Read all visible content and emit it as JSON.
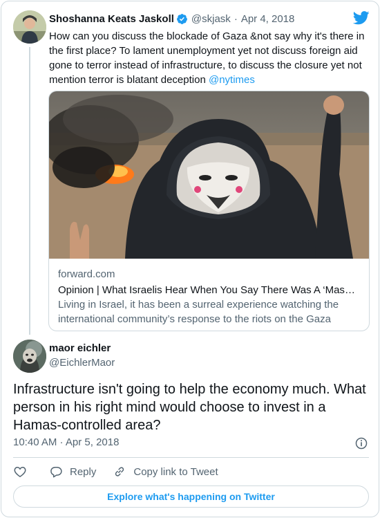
{
  "colors": {
    "accent": "#1d9bf0",
    "muted": "#536471",
    "border": "#cfd9de",
    "text": "#0f1419"
  },
  "parent_tweet": {
    "name": "Shoshanna Keats Jaskoll",
    "handle": "@skjask",
    "separator": "·",
    "date": "Apr 4, 2018",
    "text": "How can you discuss the blockade of Gaza &not say why it's there in the first place? To lament unemployment yet not discuss foreign aid gone to terror instead of infrastructure, to discuss the closure yet not mention terror is blatant deception ",
    "mention": "@nytimes",
    "icons": {
      "verified": "verified-badge-icon",
      "brand": "twitter-bird-icon"
    }
  },
  "link_card": {
    "domain": "forward.com",
    "title": "Opinion | What Israelis Hear When You Say There Was A ‘Massacre’ In Gaza",
    "description": "Living in Israel, it has been a surreal experience watching the international community’s response to the riots on the Gaza border."
  },
  "reply_tweet": {
    "name": "maor eichler",
    "handle": "@EichlerMaor",
    "text": "Infrastructure isn't going to help the economy much. What person in his right mind would choose to invest in a Hamas-controlled area?",
    "timestamp": "10:40 AM · Apr 5, 2018"
  },
  "actions": {
    "reply_label": "Reply",
    "copy_link_label": "Copy link to Tweet",
    "icons": [
      "heart-icon",
      "reply-icon",
      "link-icon",
      "info-icon"
    ]
  },
  "explore_button": "Explore what's happening on Twitter"
}
